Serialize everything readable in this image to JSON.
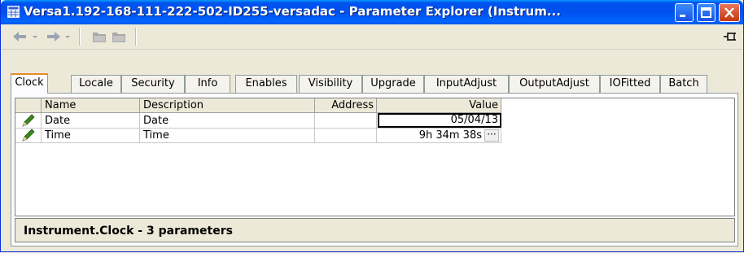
{
  "window": {
    "title": "Versa1.192-168-111-222-502-ID255-versadac - Parameter Explorer (Instrum..."
  },
  "toolbar": {
    "back_icon": "back-arrow-icon",
    "forward_icon": "forward-arrow-icon",
    "pin_icon": "pin-icon"
  },
  "tabs": [
    {
      "label": "Clock",
      "active": true
    },
    {
      "label": "Locale"
    },
    {
      "label": "Security"
    },
    {
      "label": "Info"
    },
    {
      "label": "Enables"
    },
    {
      "label": "Visibility"
    },
    {
      "label": "Upgrade"
    },
    {
      "label": "InputAdjust"
    },
    {
      "label": "OutputAdjust"
    },
    {
      "label": "IOFitted"
    },
    {
      "label": "Batch"
    }
  ],
  "table": {
    "columns": [
      "Name",
      "Description",
      "Address",
      "Value"
    ],
    "rows": [
      {
        "name": "Date",
        "description": "Date",
        "address": "",
        "value": "05/04/13",
        "editable_icon": "pencil-icon"
      },
      {
        "name": "Time",
        "description": "Time",
        "address": "",
        "value": "9h 34m 38s",
        "editable_icon": "pencil-icon",
        "ellipsis": "···"
      }
    ]
  },
  "status": {
    "text": "Instrument.Clock  -  3 parameters"
  },
  "colors": {
    "titlebar": "#0053ee",
    "active_tab_highlight": "#e68b2c",
    "pencil": "#3a8a1e"
  }
}
